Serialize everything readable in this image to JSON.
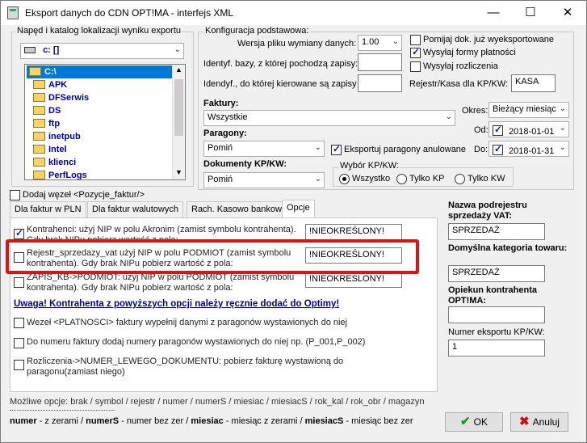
{
  "window": {
    "title": "Eksport danych do CDN OPT!MA - interfejs XML",
    "minimize": "—",
    "maximize": "☐",
    "close": "✕"
  },
  "drive": {
    "group_title": "Napęd i katalog lokalizacji wyniku exportu",
    "drive_value": "c: []",
    "folders": [
      "C:\\",
      "APK",
      "DFSerwis",
      "DS",
      "ftp",
      "inetpub",
      "Intel",
      "klienci",
      "PerfLogs"
    ]
  },
  "config": {
    "group_title": "Konfiguracja podstawowa:",
    "version_label": "Wersja pliku wymiany danych:",
    "version_value": "1.00",
    "db_id_label": "Identyf. bazy, z której pochodzą zapisy:",
    "db_id_value": "",
    "kp_id_label": "Idendyf., do której kierowane są zapisy",
    "kp_id_value": "",
    "skip_label": "Pomijaj dok. już wyeksportowane",
    "skip_checked": false,
    "send_payment_label": "Wysyłaj formy płatności",
    "send_payment_checked": true,
    "send_settlements_label": "Wysyłaj rozliczenia",
    "send_settlements_checked": false,
    "register_label": "Rejestr/Kasa dla KP/KW:",
    "register_value": "KASA"
  },
  "filters": {
    "invoices_label": "Faktury:",
    "invoices_value": "Wszystkie",
    "period_label": "Okres:",
    "period_value": "Bieżący miesiąc",
    "from_label": "Od:",
    "from_value": "2018-01-01",
    "to_label": "Do:",
    "to_value": "2018-01-31",
    "receipts_label": "Paragony:",
    "receipts_value": "Pomiń",
    "export_cancelled_label": "Eksportuj paragony anulowane",
    "export_cancelled_checked": true,
    "kpkw_label": "Dokumenty KP/KW:",
    "kpkw_value": "Pomiń",
    "kpkw_choice_title": "Wybór KP/KW:",
    "kpkw_all": "Wszystko",
    "kpkw_only_kp": "Tylko KP",
    "kpkw_only_kw": "Tylko KW",
    "kpkw_selected": "Wszystko"
  },
  "add_node": {
    "label": "Dodaj węzeł <Pozycje_faktur/>",
    "checked": false
  },
  "tabs": [
    {
      "label": "Dla faktur w PLN",
      "active": false
    },
    {
      "label": "Dla faktur walutowych",
      "active": false
    },
    {
      "label": "Rach. Kasowo bankowy",
      "active": false
    },
    {
      "label": "Opcje",
      "active": true
    }
  ],
  "options": {
    "opt1_text": "Kontrahenci: użyj NIP w polu Akronim (zamist symbolu kontrahenta). Gdy brak NIPu pobierz wartość z pola:",
    "opt1_checked": true,
    "opt1_value": "!NIEOKREŚLONY!",
    "opt2_text": "Rejestr_sprzedazy_vat użyj NIP w polu PODMIOT (zamist symbolu kontrahenta). Gdy brak NIPu pobierz wartość z pola:",
    "opt2_checked": false,
    "opt2_value": "!NIEOKREŚLONY!",
    "opt3_text": "ZAPIS_KB->PODMIOT: użyj NIP w polu PODMIOT (zamist symbolu kontrahenta). Gdy brak NIPu pobierz wartość z pola:",
    "opt3_checked": false,
    "opt3_value": "!NIEOKREŚLONY!",
    "warning": "Uwaga! Kontrahenta z powyższych opcji należy ręcznie dodać do Optimy!",
    "opt4_text": "Wezeł <PLATNOSCI> faktury wypełnij danymi z paragonów wystawionych do niej",
    "opt5_text": "Do numeru faktury dodaj numery paragonów wystawionych do niej np. (P_001,P_002)",
    "opt6_text": "Rozliczenia->NUMER_LEWEGO_DOKUMENTU: pobierz fakturę wystawioną do paragonu(zamiast niego)"
  },
  "right_panel": {
    "subregister_label": "Nazwa podrejestru sprzedaży VAT:",
    "subregister_value": "SPRZEDAŻ",
    "category_label": "Domyślna kategoria towaru:",
    "category_value": "SPRZEDAŻ",
    "guardian_label": "Opiekun kontrahenta OPT!MA:",
    "guardian_value": "",
    "export_no_label": "Numer eksportu KP/KW:",
    "export_no_value": "1"
  },
  "footer": {
    "options_hint": "Możliwe opcje: brak / symbol / rejestr / numer / numerS / miesiac / miesiacS / rok_kal / rok_obr / magazyn",
    "numer": "numer",
    "numer_desc": " - z zerami / ",
    "numerS": "numerS",
    "numerS_desc": " - numer bez zer / ",
    "miesiac": "miesiac",
    "miesiac_desc": " - miesiąc z zerami / ",
    "miesiacS": "miesiacS",
    "miesiacS_desc": " - miesiąc bez zer",
    "ok": "OK",
    "cancel": "Anuluj"
  },
  "colors": {
    "highlight_red": "#d41717",
    "tree_text": "#0000a0",
    "selection": "#0078d7"
  }
}
